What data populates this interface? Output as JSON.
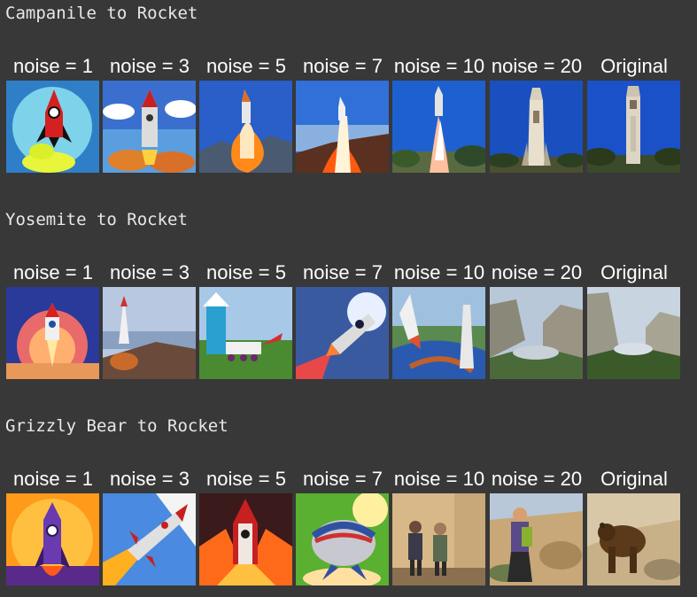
{
  "sections": [
    {
      "title": "Campanile to Rocket",
      "cells": [
        {
          "label": "noise = 1",
          "image": "cartoon-rocket-blue-circle"
        },
        {
          "label": "noise = 3",
          "image": "rocket-over-clouds"
        },
        {
          "label": "noise = 5",
          "image": "rocket-launch-mountains"
        },
        {
          "label": "noise = 7",
          "image": "rocket-launch-sunset"
        },
        {
          "label": "noise = 10",
          "image": "rocket-launch-treeline"
        },
        {
          "label": "noise = 20",
          "image": "campanile-rocket-tower"
        },
        {
          "label": "Original",
          "image": "campanile-tower"
        }
      ]
    },
    {
      "title": "Yosemite to Rocket",
      "cells": [
        {
          "label": "noise = 1",
          "image": "rocket-glow-orb"
        },
        {
          "label": "noise = 3",
          "image": "rocket-launch-cliff"
        },
        {
          "label": "noise = 5",
          "image": "rocket-cabin-field"
        },
        {
          "label": "noise = 7",
          "image": "rocket-flying-sky"
        },
        {
          "label": "noise = 10",
          "image": "rocket-over-valley"
        },
        {
          "label": "noise = 20",
          "image": "yosemite-valley-hazy"
        },
        {
          "label": "Original",
          "image": "yosemite-valley"
        }
      ]
    },
    {
      "title": "Grizzly Bear to Rocket",
      "cells": [
        {
          "label": "noise = 1",
          "image": "purple-rocket-flames"
        },
        {
          "label": "noise = 3",
          "image": "silver-rocket-diagonal"
        },
        {
          "label": "noise = 5",
          "image": "red-rocket-fire"
        },
        {
          "label": "noise = 7",
          "image": "round-rocket-ship"
        },
        {
          "label": "noise = 10",
          "image": "people-in-hallway"
        },
        {
          "label": "noise = 20",
          "image": "person-on-rocky-slope"
        },
        {
          "label": "Original",
          "image": "grizzly-bear-rocks"
        }
      ]
    }
  ],
  "colors": {
    "background": "#383838",
    "label_text": "#ffffff",
    "title_text": "#e8e8e8"
  }
}
